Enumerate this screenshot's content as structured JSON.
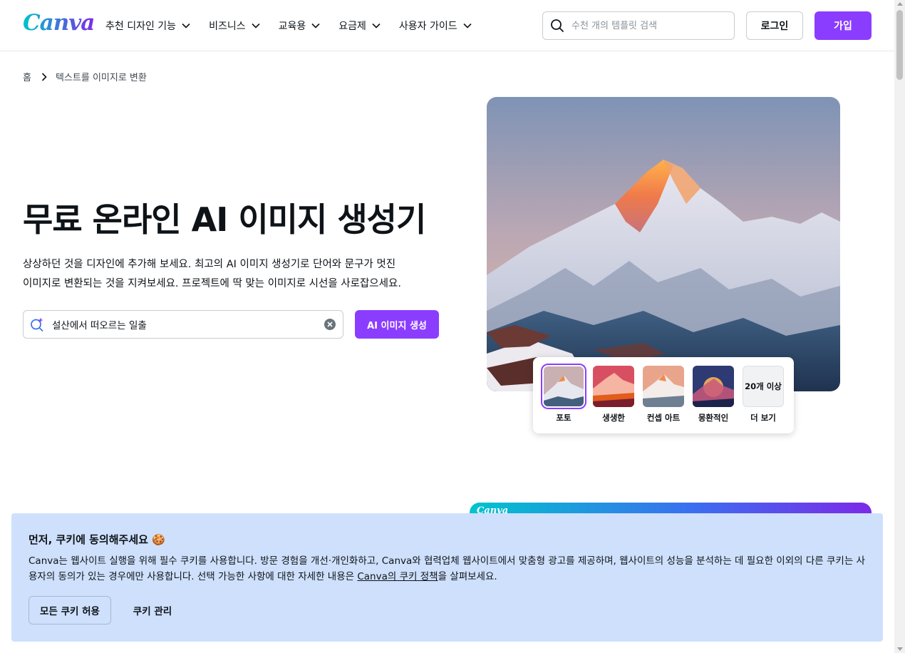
{
  "header": {
    "logo_text": "Canva",
    "nav": [
      {
        "label": "추천 디자인 기능"
      },
      {
        "label": "비즈니스"
      },
      {
        "label": "교육용"
      },
      {
        "label": "요금제"
      },
      {
        "label": "사용자 가이드"
      }
    ],
    "search_placeholder": "수천 개의 템플릿 검색",
    "login_label": "로그인",
    "signup_label": "가입"
  },
  "breadcrumb": {
    "home": "홈",
    "current": "텍스트를 이미지로 변환"
  },
  "hero": {
    "title": "무료 온라인 AI 이미지 생성기",
    "description_line1": "상상하던 것을 디자인에 추가해 보세요. 최고의 AI 이미지 생성기로 단어와 문구가 멋진",
    "description_line2": "이미지로 변환되는 것을 지켜보세요. 프로젝트에 딱 맞는 이미지로 시선을 사로잡으세요.",
    "prompt_value": "설산에서 떠오르는 일출",
    "generate_label": "AI 이미지 생성"
  },
  "styles": {
    "options": [
      {
        "label": "포토"
      },
      {
        "label": "생생한"
      },
      {
        "label": "컨셉 아트"
      },
      {
        "label": "몽환적인"
      }
    ],
    "more_thumb": "20개 이상",
    "more_label": "더 보기"
  },
  "promo": {
    "logo_text": "Canva"
  },
  "cookie": {
    "title": "먼저, 쿠키에 동의해주세요 🍪",
    "body_part1": "Canva는 웹사이트 실행을 위해 필수 쿠키를 사용합니다. 방문 경험을 개선·개인화하고, Canva와 협력업체 웹사이트에서 맞춤형 광고를 제공하며, 웹사이트의 성능을 분석하는 데 필요한 이외의 다른 쿠키는 사용자의 동의가 있는 경우에만 사용합니다. 선택 가능한 사항에 대한 자세한 내용은 ",
    "link_text": "Canva의 쿠키 정책",
    "body_part2": "을 살펴보세요.",
    "accept_label": "모든 쿠키 허용",
    "manage_label": "쿠키 관리"
  },
  "colors": {
    "brand_purple": "#8b3dff",
    "cookie_bg": "#cfe0fc"
  }
}
